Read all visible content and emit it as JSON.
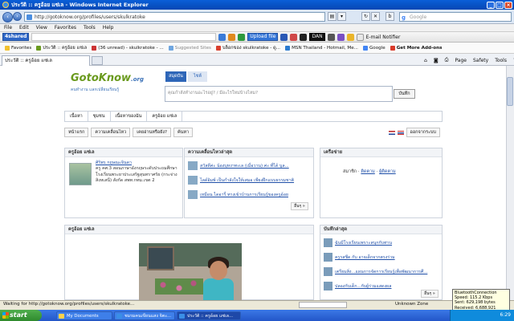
{
  "window": {
    "title": "ประวัติ :: ครูอ้อย แซ่เล - Windows Internet Explorer"
  },
  "address": {
    "url": "http://gotoknow.org/profiles/users/skulkratoke",
    "search_placeholder": "Google"
  },
  "menu": [
    "File",
    "Edit",
    "View",
    "Favorites",
    "Tools",
    "Help"
  ],
  "toolbar": {
    "shared_label": "4shared",
    "upload_label": "Upload file",
    "dan_label": "DAN",
    "email_notifier": "E-mail Notifier"
  },
  "favorites_bar": {
    "favorites_label": "Favorites",
    "items": [
      "ประวัติ :: ครูอ้อย แซ่เล",
      "(36 unread) - skulkratoke - ...",
      "Suggested Sites",
      "บล็อกของ skulkratoke - ดู...",
      "MSN  Thailand - Hotmail, Me...",
      "Google",
      "Get More Add-ons"
    ]
  },
  "tabs": {
    "active_tab": "ประวัติ :: ครูอ้อย แซ่เล",
    "commands": [
      "Page",
      "Safety",
      "Tools"
    ]
  },
  "site": {
    "logo_main": "GotoKnow",
    "logo_suffix": ".org",
    "tagline": "คนทำงาน แลกเปลี่ยนเรียนรู้",
    "top_tabs": [
      "สมุดบัน",
      "ไซต์"
    ],
    "status_placeholder": "คุณกำลังทำงานอะไรอยู่? / มีอะไรใหม่บ้างไหม?",
    "save_button": "บันทึก",
    "nav_tabs": [
      "เนื้อหา",
      "ชุมชน",
      "เนื้อหาของฉัน",
      "ครูอ้อย แซ่เล"
    ],
    "sub_buttons": [
      "หน้าแรก",
      "ความเคลื่อนไหว",
      "เคยอ่านหรือยัง?",
      "ค้นหา"
    ],
    "logout": "ออกจากระบบ"
  },
  "profile_panel": {
    "header": "ครูอ้อย แซ่เล",
    "name_link": "ศิริพร กฤษณะจินดา",
    "line1": "ครู คศ.3 สอนภาษาอังกฤษระดับประถมศึกษา",
    "line2": "โรงเรียนพระยาประเสริฐสุนทราศรัย (กระจ่าง สิงหเสนี) สังกัด สพท.กทม.เขต 2"
  },
  "moves_panel": {
    "header": "ความเคลื่อนไหวล่าสุด",
    "items": [
      "สวัสดีค่ะ น้องบุหงาทะเล (เมื่อวาน) ค่ะ ที่ได้ บูล...",
      "ไลด์อิมพ์ เป็นกำลังใจให้เสมอ เพียงฝึกแบบธรรมชาติ",
      "เหมือน ไดอารี่ ทางเข้าบ้านการเรียนรู้ของครูอ้อย"
    ],
    "more_label": "อื่นๆ »"
  },
  "network_panel": {
    "header": "เครือข่าย",
    "member_label": "สมาชิก",
    "follow_label": "ติดตาม",
    "follower_label": "ผู้ติดตาม"
  },
  "photo_panel": {
    "header": "ครูอ้อย แซ่เล"
  },
  "notes_panel": {
    "header": "บันทึกล่าสุด",
    "items": [
      "ฉันมีโรงเรียนเพราะสนุกกับท่าน",
      "ครูรสชีด กับ อาจเด็กจากตรงร่วม",
      "เตรียมสิ่ง...แผนการจัดการเรียนรู้เพื่อพัฒนาการศึ...",
      "ปลองกับเด็ก...กับผู้ร่วมแสดงผล"
    ],
    "more_label": "อื่นๆ »"
  },
  "statusbar": {
    "loading_text": "Waiting for http://gotoknow.org/profiles/users/skulkratoke...",
    "zone": "Unknown Zone"
  },
  "taskbar": {
    "start_label": "start",
    "tasks": [
      "My Documents",
      "ชมรมคนเขียนแสง จิตะ...",
      "ประวัติ :: ครูอ้อย แซ่เล..."
    ],
    "clock": "6:29"
  },
  "tooltip": {
    "title": "BluetoothConnection",
    "speed": "Speed: 115.2 Kbps",
    "sent": "Sent: 629,198 bytes",
    "received": "Received: 6,688,921 bytes"
  }
}
